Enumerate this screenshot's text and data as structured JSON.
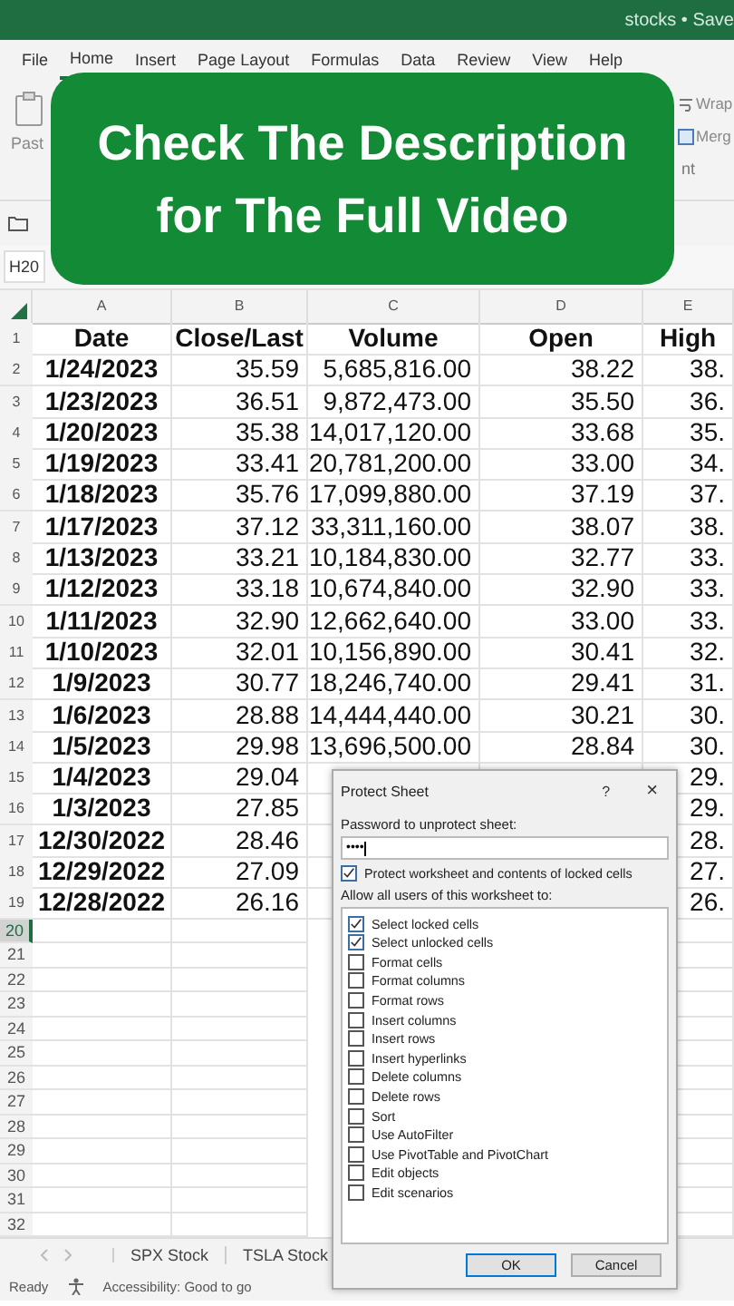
{
  "title_bar": {
    "title": "stocks • Save"
  },
  "ribbon_tabs": [
    {
      "label": "File",
      "selected": false
    },
    {
      "label": "Home",
      "selected": true
    },
    {
      "label": "Insert",
      "selected": false
    },
    {
      "label": "Page Layout",
      "selected": false
    },
    {
      "label": "Formulas",
      "selected": false
    },
    {
      "label": "Data",
      "selected": false
    },
    {
      "label": "Review",
      "selected": false
    },
    {
      "label": "View",
      "selected": false
    },
    {
      "label": "Help",
      "selected": false
    }
  ],
  "ribbon": {
    "paste_label": "Past",
    "wrap_label": "Wrap",
    "merge_label": "Merg",
    "group_label": "nt"
  },
  "banner": {
    "lines": [
      "Check The Description",
      "for The Full Video"
    ]
  },
  "name_box": "H20",
  "columns": [
    "A",
    "B",
    "C",
    "D",
    "E"
  ],
  "rows": [
    {
      "num": "1",
      "kind": "header",
      "cells": [
        "Date",
        "Close/Last",
        "Volume",
        "Open",
        "High"
      ]
    },
    {
      "num": "2",
      "cells": [
        "1/24/2023",
        "35.59",
        "5,685,816.00",
        "38.22",
        "38."
      ]
    },
    {
      "num": "3",
      "cells": [
        "1/23/2023",
        "36.51",
        "9,872,473.00",
        "35.50",
        "36."
      ]
    },
    {
      "num": "4",
      "cells": [
        "1/20/2023",
        "35.38",
        "14,017,120.00",
        "33.68",
        "35."
      ]
    },
    {
      "num": "5",
      "cells": [
        "1/19/2023",
        "33.41",
        "20,781,200.00",
        "33.00",
        "34."
      ]
    },
    {
      "num": "6",
      "cells": [
        "1/18/2023",
        "35.76",
        "17,099,880.00",
        "37.19",
        "37."
      ]
    },
    {
      "num": "7",
      "cells": [
        "1/17/2023",
        "37.12",
        "33,311,160.00",
        "38.07",
        "38."
      ]
    },
    {
      "num": "8",
      "cells": [
        "1/13/2023",
        "33.21",
        "10,184,830.00",
        "32.77",
        "33."
      ]
    },
    {
      "num": "9",
      "cells": [
        "1/12/2023",
        "33.18",
        "10,674,840.00",
        "32.90",
        "33."
      ]
    },
    {
      "num": "10",
      "cells": [
        "1/11/2023",
        "32.90",
        "12,662,640.00",
        "33.00",
        "33."
      ]
    },
    {
      "num": "11",
      "cells": [
        "1/10/2023",
        "32.01",
        "10,156,890.00",
        "30.41",
        "32."
      ]
    },
    {
      "num": "12",
      "cells": [
        "1/9/2023",
        "30.77",
        "18,246,740.00",
        "29.41",
        "31."
      ]
    },
    {
      "num": "13",
      "cells": [
        "1/6/2023",
        "28.88",
        "14,444,440.00",
        "30.21",
        "30."
      ]
    },
    {
      "num": "14",
      "cells": [
        "1/5/2023",
        "29.98",
        "13,696,500.00",
        "28.84",
        "30."
      ]
    },
    {
      "num": "15",
      "cells": [
        "1/4/2023",
        "29.04",
        null,
        null,
        "29."
      ]
    },
    {
      "num": "16",
      "cells": [
        "1/3/2023",
        "27.85",
        null,
        null,
        "29."
      ]
    },
    {
      "num": "17",
      "cells": [
        "12/30/2022",
        "28.46",
        null,
        null,
        "28."
      ]
    },
    {
      "num": "18",
      "cells": [
        "12/29/2022",
        "27.09",
        null,
        null,
        "27."
      ]
    },
    {
      "num": "19",
      "cells": [
        "12/28/2022",
        "26.16",
        null,
        null,
        "26."
      ]
    }
  ],
  "empty_rows": [
    {
      "num": "20",
      "selected": true
    },
    {
      "num": "21",
      "selected": false
    },
    {
      "num": "22",
      "selected": false
    },
    {
      "num": "23",
      "selected": false
    },
    {
      "num": "24",
      "selected": false
    },
    {
      "num": "25",
      "selected": false
    },
    {
      "num": "26",
      "selected": false
    },
    {
      "num": "27",
      "selected": false
    },
    {
      "num": "28",
      "selected": false
    },
    {
      "num": "29",
      "selected": false
    },
    {
      "num": "30",
      "selected": false
    },
    {
      "num": "31",
      "selected": false
    },
    {
      "num": "32",
      "selected": false
    }
  ],
  "sheet_tabs": [
    {
      "label": "SPX Stock",
      "selected": false
    },
    {
      "label": "TSLA Stock",
      "selected": false
    }
  ],
  "status_bar": {
    "ready": "Ready",
    "accessibility": "Accessibility: Good to go"
  },
  "dialog": {
    "title": "Protect Sheet",
    "help": "?",
    "close": "×",
    "password_label": "Password to unprotect sheet:",
    "password_value": "••••",
    "protect": {
      "label": "Protect worksheet and contents of locked cells",
      "checked": true
    },
    "allow_label": "Allow all users of this worksheet to:",
    "permissions": [
      {
        "label": "Select locked cells",
        "checked": true
      },
      {
        "label": "Select unlocked cells",
        "checked": true
      },
      {
        "label": "Format cells",
        "checked": false
      },
      {
        "label": "Format columns",
        "checked": false
      },
      {
        "label": "Format rows",
        "checked": false
      },
      {
        "label": "Insert columns",
        "checked": false
      },
      {
        "label": "Insert rows",
        "checked": false
      },
      {
        "label": "Insert hyperlinks",
        "checked": false
      },
      {
        "label": "Delete columns",
        "checked": false
      },
      {
        "label": "Delete rows",
        "checked": false
      },
      {
        "label": "Sort",
        "checked": false
      },
      {
        "label": "Use AutoFilter",
        "checked": false
      },
      {
        "label": "Use PivotTable and PivotChart",
        "checked": false
      },
      {
        "label": "Edit objects",
        "checked": false
      },
      {
        "label": "Edit scenarios",
        "checked": false
      }
    ],
    "ok": "OK",
    "cancel": "Cancel"
  }
}
